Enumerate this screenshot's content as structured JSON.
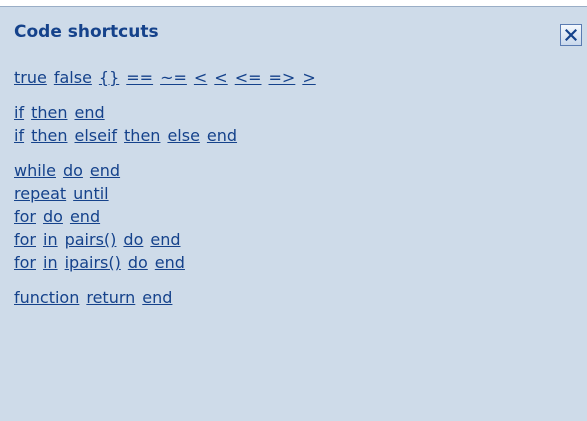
{
  "panel": {
    "title": "Code shortcuts",
    "close_icon": "close-icon"
  },
  "groups": [
    {
      "lines": [
        [
          "true",
          "false",
          "{}",
          "==",
          "~=",
          "<",
          "<",
          "<=",
          "=>",
          ">"
        ]
      ]
    },
    {
      "lines": [
        [
          "if",
          "then",
          "end"
        ],
        [
          "if",
          "then",
          "elseif",
          "then",
          "else",
          "end"
        ]
      ]
    },
    {
      "lines": [
        [
          "while",
          "do",
          "end"
        ],
        [
          "repeat",
          "until"
        ],
        [
          "for",
          "do",
          "end"
        ],
        [
          "for",
          "in",
          "pairs()",
          "do",
          "end"
        ],
        [
          "for",
          "in",
          "ipairs()",
          "do",
          "end"
        ]
      ]
    },
    {
      "lines": [
        [
          "function",
          "return",
          "end"
        ]
      ]
    }
  ],
  "colors": {
    "panel_bg": "#cedbe9",
    "link": "#15428b"
  }
}
